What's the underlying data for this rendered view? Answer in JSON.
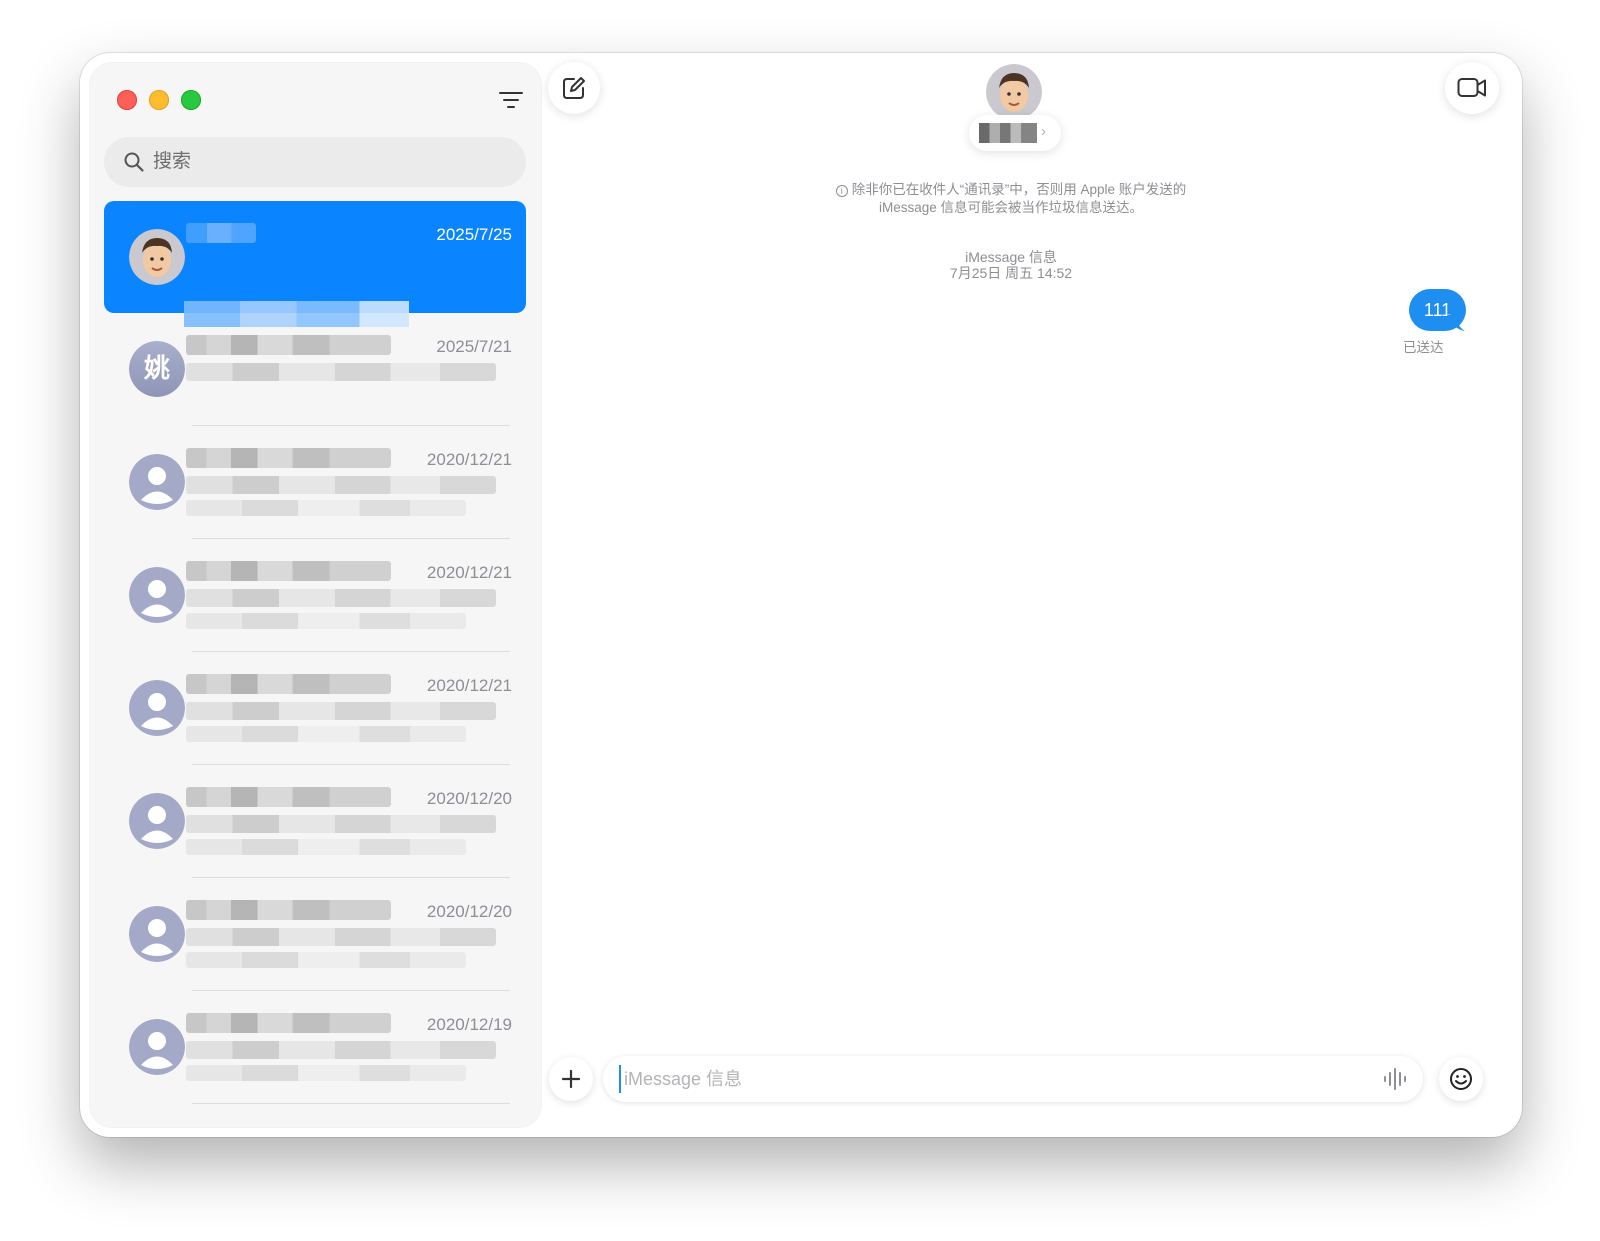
{
  "sidebar": {
    "search": {
      "placeholder": "搜索"
    },
    "conversations": [
      {
        "date": "2025/7/25",
        "avatar": "memoji",
        "selected": true
      },
      {
        "date": "2025/7/21",
        "avatar": "initial",
        "initial": "姚"
      },
      {
        "date": "2020/12/21",
        "avatar": "person-icon"
      },
      {
        "date": "2020/12/21",
        "avatar": "person-icon"
      },
      {
        "date": "2020/12/21",
        "avatar": "person-icon"
      },
      {
        "date": "2020/12/20",
        "avatar": "person-icon"
      },
      {
        "date": "2020/12/20",
        "avatar": "person-icon"
      },
      {
        "date": "2020/12/19",
        "avatar": "person-icon"
      }
    ]
  },
  "chat": {
    "notice_line1": "除非你已在收件人“通讯录”中，否则用 Apple 账户发送的",
    "notice_line2": "iMessage 信息可能会被当作垃圾信息送达。",
    "service_label": "iMessage 信息",
    "timestamp": "7月25日 周五 14:52",
    "messages": [
      {
        "text": "111",
        "from": "me",
        "status": "已送达"
      }
    ],
    "input_placeholder": "iMessage 信息"
  },
  "colors": {
    "accent": "#0a84ff",
    "bubble": "#1f8ef1",
    "avatar_gray": "#a3a9c7"
  }
}
